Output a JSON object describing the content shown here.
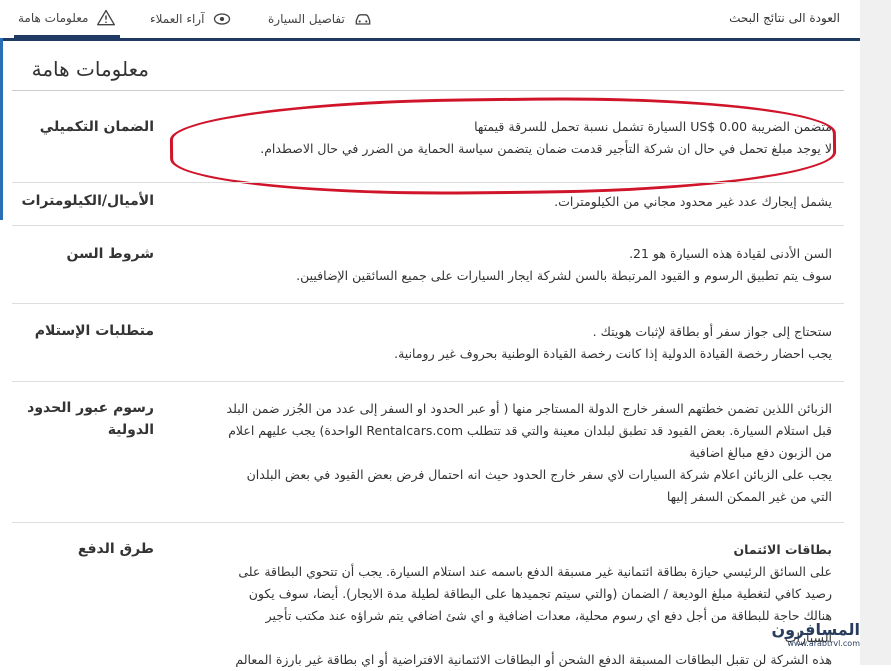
{
  "nav": {
    "back_label": "العودة الى نتائج البحث",
    "tabs": [
      {
        "label": "تفاصيل السيارة",
        "icon": "car-icon"
      },
      {
        "label": "آراء العملاء",
        "icon": "eye-icon"
      },
      {
        "label": "معلومات هامة",
        "icon": "warning-icon",
        "active": true
      }
    ]
  },
  "page": {
    "title": "معلومات هامة"
  },
  "sections": [
    {
      "label": "الضمان التكميلي",
      "lines": [
        "متضمن الضريبة US$ 0.00 السيارة تشمل نسبة تحمل للسرقة قيمتها",
        "لا يوجد مبلغ تحمل في حال ان شركة التأجير قدمت ضمان يتضمن سياسة الحماية من الضرر في حال الاصطدام."
      ]
    },
    {
      "label": "الأميال/الكيلومترات",
      "lines": [
        "يشمل إيجارك عدد غير محدود مجاني من الكيلومترات."
      ]
    },
    {
      "label": "شروط السن",
      "lines": [
        "السن الأدنى لقيادة هذه السيارة هو 21.",
        "سوف يتم تطبيق الرسوم و القيود المرتبطة بالسن لشركة ايجار السيارات على جميع السائقين الإضافيين."
      ]
    },
    {
      "label": "متطلبات الإستلام",
      "lines": [
        "ستحتاج إلى جواز سفر أو بطاقة لإثبات هويتك .",
        "يجب احضار رخصة القيادة الدولية إذا كانت رخصة القيادة الوطنية بحروف غير رومانية."
      ]
    },
    {
      "label": "رسوم عبور الحدود الدولية",
      "lines": [
        "الزبائن اللذين تضمن خطتهم السفر خارج الدولة المستاجر منها ( أو عبر الحدود او السفر إلى عدد من الجُزر ضمن البلد",
        "قبل استلام السيارة. بعض القيود قد تطبق لبلدان معينة والتي قد تتطلب Rentalcars.com الواحدة) يجب عليهم اعلام",
        "من الزبون دفع مبالغ اضافية",
        "يجب على الزبائن اعلام شركة السيارات لاي سفر خارج الحدود حيث انه احتمال فرض بعض القيود في بعض البلدان",
        "التي من غير الممكن السفر إليها"
      ]
    },
    {
      "label": "طرق الدفع",
      "heading": "بطاقات الائتمان",
      "lines": [
        "على السائق الرئيسي حيازة بطاقة ائتمانية غير مسبقة الدفع باسمه عند استلام السيارة. يجب أن تتحوي البطاقة على",
        "رصيد كافي لتغطية مبلغ الوديعة / الضمان (والتي سيتم تجميدها على البطاقة لطيلة مدة الايجار). أيضا، سوف يكون",
        "هنالك حاجة للبطاقة من أجل دفع اي رسوم محلية، معدات اضافية و اي شئ اضافي يتم شراؤه عند مكتب تأجير",
        "السيارات",
        "هذه الشركة لن تقبل البطاقات المسبقة الدفع الشحن أو البطاقات الائتمانية الافتراضية أو اي بطاقة غير بارزة المعالم"
      ]
    }
  ],
  "watermark": {
    "text": "المسافرون",
    "sub": "www.arabtrvl.com"
  },
  "colors": {
    "accent": "#1f3a63",
    "annotation": "#d0142a"
  }
}
